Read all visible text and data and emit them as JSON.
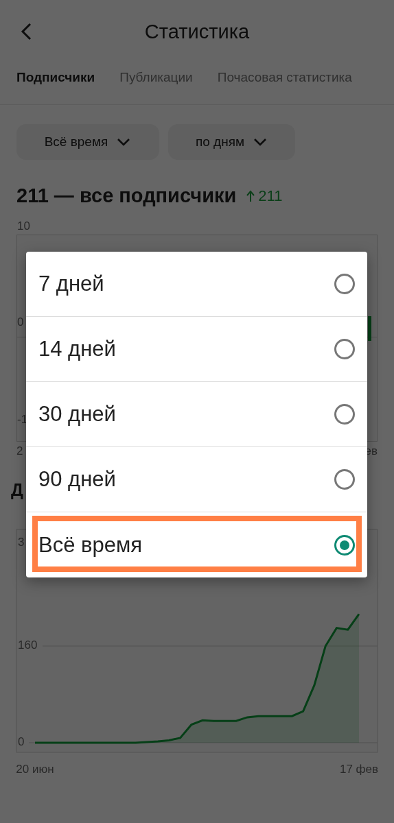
{
  "header": {
    "title": "Статистика"
  },
  "tabs": [
    {
      "label": "Подписчики",
      "selected": true
    },
    {
      "label": "Публикации",
      "selected": false
    },
    {
      "label": "Почасовая статистика",
      "selected": false
    }
  ],
  "filters": [
    {
      "label": "Всё время"
    },
    {
      "label": "по дням"
    }
  ],
  "subscribers": {
    "total": "211 — все подписчики",
    "growth": "211"
  },
  "chart_1_fragments": {
    "y_labels": [
      "10",
      "0",
      "-1"
    ],
    "x_start": "2",
    "x_end": "ев"
  },
  "section_2_heading": "Д",
  "growth_chart": {
    "top_label_fragment": "3",
    "chart_data": {
      "type": "area",
      "categories": [
        "20 июн",
        null,
        null,
        null,
        null,
        null,
        null,
        null,
        null,
        null,
        null,
        null,
        null,
        null,
        null,
        null,
        null,
        null,
        null,
        null,
        null,
        null,
        null,
        null,
        null,
        null,
        null,
        null,
        null,
        "17 фев"
      ],
      "series": [
        {
          "color": "#0f9d3a",
          "values": [
            0,
            0,
            0,
            0,
            0,
            0,
            0,
            0,
            0,
            0,
            1,
            2,
            4,
            8,
            30,
            37,
            36,
            36,
            36,
            42,
            44,
            44,
            44,
            44,
            52,
            95,
            160,
            190,
            187,
            213
          ]
        }
      ],
      "ylim": [
        -16,
        353
      ],
      "yticks": [
        0,
        160
      ]
    }
  },
  "period_dialog": {
    "options": [
      {
        "label": "7 дней",
        "selected": false,
        "highlighted": false
      },
      {
        "label": "14 дней",
        "selected": false,
        "highlighted": false
      },
      {
        "label": "30 дней",
        "selected": false,
        "highlighted": false
      },
      {
        "label": "90 дней",
        "selected": false,
        "highlighted": false
      },
      {
        "label": "Всё время",
        "selected": true,
        "highlighted": true
      }
    ]
  }
}
